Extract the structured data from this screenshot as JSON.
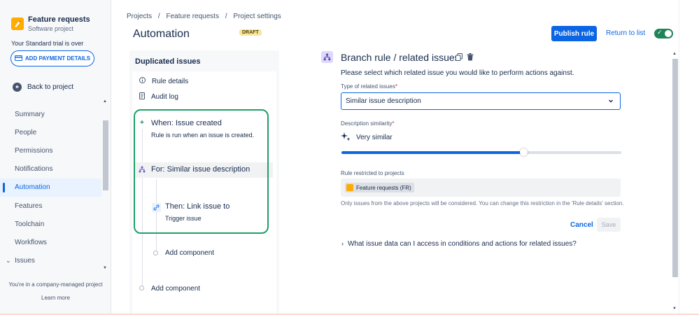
{
  "sidebar": {
    "project_name": "Feature requests",
    "project_type": "Software project",
    "trial_text": "Your Standard trial is over",
    "payment_button": "ADD PAYMENT DETAILS",
    "back_label": "Back to project",
    "items": [
      {
        "label": "Summary"
      },
      {
        "label": "People"
      },
      {
        "label": "Permissions"
      },
      {
        "label": "Notifications"
      },
      {
        "label": "Automation"
      },
      {
        "label": "Features"
      },
      {
        "label": "Toolchain"
      },
      {
        "label": "Workflows"
      },
      {
        "label": "Issues"
      }
    ],
    "managed_text": "You're in a company-managed project",
    "learn_more": "Learn more"
  },
  "header": {
    "breadcrumb": [
      "Projects",
      "/",
      "Feature requests",
      "/",
      "Project settings"
    ],
    "title": "Automation",
    "draft_badge": "DRAFT",
    "publish_button": "Publish rule",
    "return_link": "Return to list"
  },
  "rule": {
    "panel_title": "Duplicated issues",
    "rule_details": "Rule details",
    "audit_log": "Audit log",
    "trigger_title": "When: Issue created",
    "trigger_sub": "Rule is run when an issue is created.",
    "branch_title": "For: Similar issue description",
    "action_title": "Then: Link issue to",
    "action_sub": "Trigger issue",
    "add_component_inner": "Add component",
    "add_component_outer": "Add component"
  },
  "branch": {
    "title": "Branch rule / related issues",
    "instructions": "Please select which related issue you would like to perform actions against.",
    "type_label": "Type of related issues",
    "type_required": "*",
    "type_value": "Similar issue description",
    "similarity_label": "Description similarity",
    "similarity_required": "*",
    "similarity_value": "Very similar",
    "similarity_level": 0.65,
    "restricted_label": "Rule restricted to projects",
    "project_chip": "Feature requests (FR)",
    "helper_text": "Only issues from the above projects will be considered. You can change this restriction in the 'Rule details' section.",
    "cancel": "Cancel",
    "save": "Save",
    "faq": "What issue data can I access in conditions and actions for related issues?"
  }
}
